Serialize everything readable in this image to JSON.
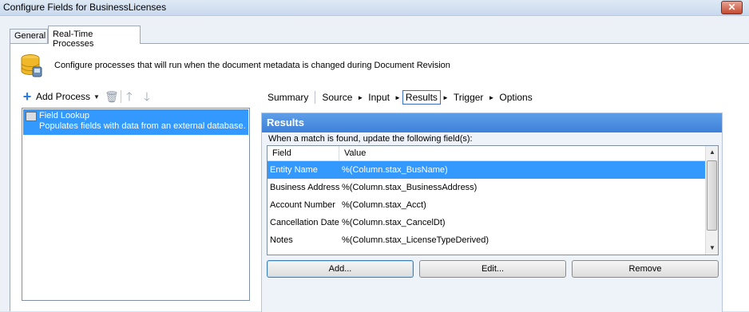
{
  "window": {
    "title": "Configure Fields for BusinessLicenses",
    "close_label": "✕"
  },
  "tabs": [
    {
      "label": "General"
    },
    {
      "label": "Real-Time Processes"
    }
  ],
  "description": "Configure processes that will run when the document metadata is changed during Document Revision",
  "toolbar": {
    "add_process_label": "Add Process"
  },
  "process_list": {
    "items": [
      {
        "name": "Field Lookup",
        "description": "Populates fields with data from an external database."
      }
    ]
  },
  "steps": [
    "Summary",
    "Source",
    "Input",
    "Results",
    "Trigger",
    "Options"
  ],
  "active_step": "Results",
  "results": {
    "header": "Results",
    "hint": "When a match is found, update the following field(s):",
    "columns": {
      "field": "Field",
      "value": "Value"
    },
    "rows": [
      {
        "field": "Entity Name",
        "value": "%(Column.stax_BusName)"
      },
      {
        "field": "Business Address",
        "value": "%(Column.stax_BusinessAddress)"
      },
      {
        "field": "Account Number",
        "value": "%(Column.stax_Acct)"
      },
      {
        "field": "Cancellation Date",
        "value": "%(Column.stax_CancelDt)"
      },
      {
        "field": "Notes",
        "value": "%(Column.stax_LicenseTypeDerived)"
      }
    ],
    "buttons": {
      "add": "Add...",
      "edit": "Edit...",
      "remove": "Remove"
    }
  },
  "colors": {
    "selection": "#3399ff",
    "results_header": "#4a8ddf"
  }
}
